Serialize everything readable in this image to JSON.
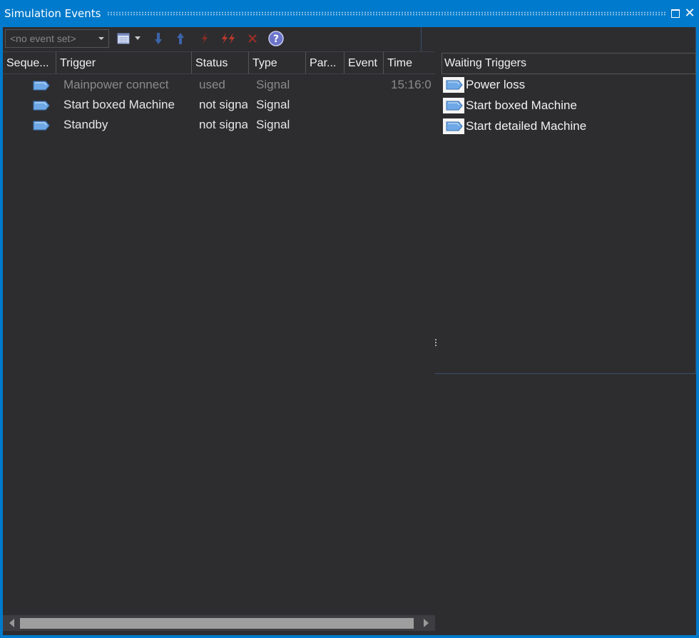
{
  "window": {
    "title": "Simulation Events"
  },
  "toolbar": {
    "event_set_value": "<no event set>",
    "icons": [
      "list-icon",
      "dropdown-arrow-icon",
      "arrow-down-icon",
      "arrow-up-icon",
      "fire-single-icon",
      "fire-double-icon",
      "delete-icon",
      "help-icon",
      "pin-arrow-icon"
    ]
  },
  "events_table": {
    "columns": [
      "Seque...",
      "Trigger",
      "Status",
      "Type",
      "Par...",
      "Event",
      "Time"
    ],
    "rows": [
      {
        "trigger": "Mainpower connect",
        "status": "used",
        "type": "Signal",
        "param": "",
        "event": "",
        "time": "15:16:0",
        "state": "used"
      },
      {
        "trigger": "Start boxed Machine",
        "status": "not signa",
        "type": "Signal",
        "param": "",
        "event": "",
        "time": "",
        "state": "active"
      },
      {
        "trigger": "Standby",
        "status": "not signa",
        "type": "Signal",
        "param": "",
        "event": "",
        "time": "",
        "state": "active"
      }
    ]
  },
  "waiting_triggers": {
    "header": "Waiting Triggers",
    "items": [
      "Power loss",
      "Start boxed Machine",
      "Start detailed Machine"
    ]
  },
  "colors": {
    "accent": "#007acc",
    "background": "#2d2d30",
    "used_text": "#8a8a8a",
    "text": "#f1f1f1"
  }
}
